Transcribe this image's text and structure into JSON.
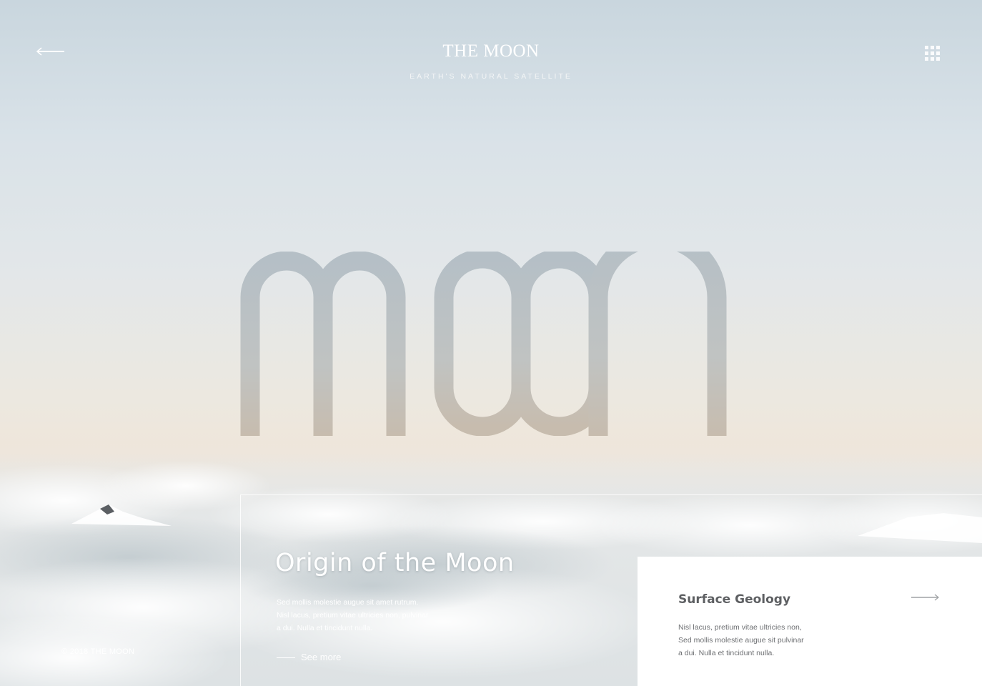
{
  "header": {
    "site_title": "THE MOON",
    "site_subtitle": "EARTH'S NATURAL SATELLITE",
    "back_icon": "arrow-left-icon",
    "menu_icon": "grid-menu-icon"
  },
  "hero": {
    "wordmark": "moon"
  },
  "feature": {
    "title": "Origin of the Moon",
    "body_lines": [
      "Sed mollis molestie augue sit amet rutrum.",
      "Nisl lacus, pretium vitae ultricies non, pulvinar",
      "a dui. Nulla et tincidunt nulla."
    ],
    "cta_label": "See more"
  },
  "card": {
    "title": "Surface Geology",
    "body_lines": [
      "Nisl lacus, pretium vitae ultricies non,",
      "Sed mollis molestie augue sit  pulvinar",
      "a dui. Nulla et tincidunt nulla."
    ],
    "arrow_icon": "arrow-right-icon"
  },
  "footer": {
    "copyright": "© 2018 THE MOON"
  },
  "colors": {
    "accent_white": "#ffffff",
    "card_text": "#6d6f72",
    "wordmark_top": "#b9c3c9",
    "wordmark_bottom": "#c8c0b4"
  }
}
